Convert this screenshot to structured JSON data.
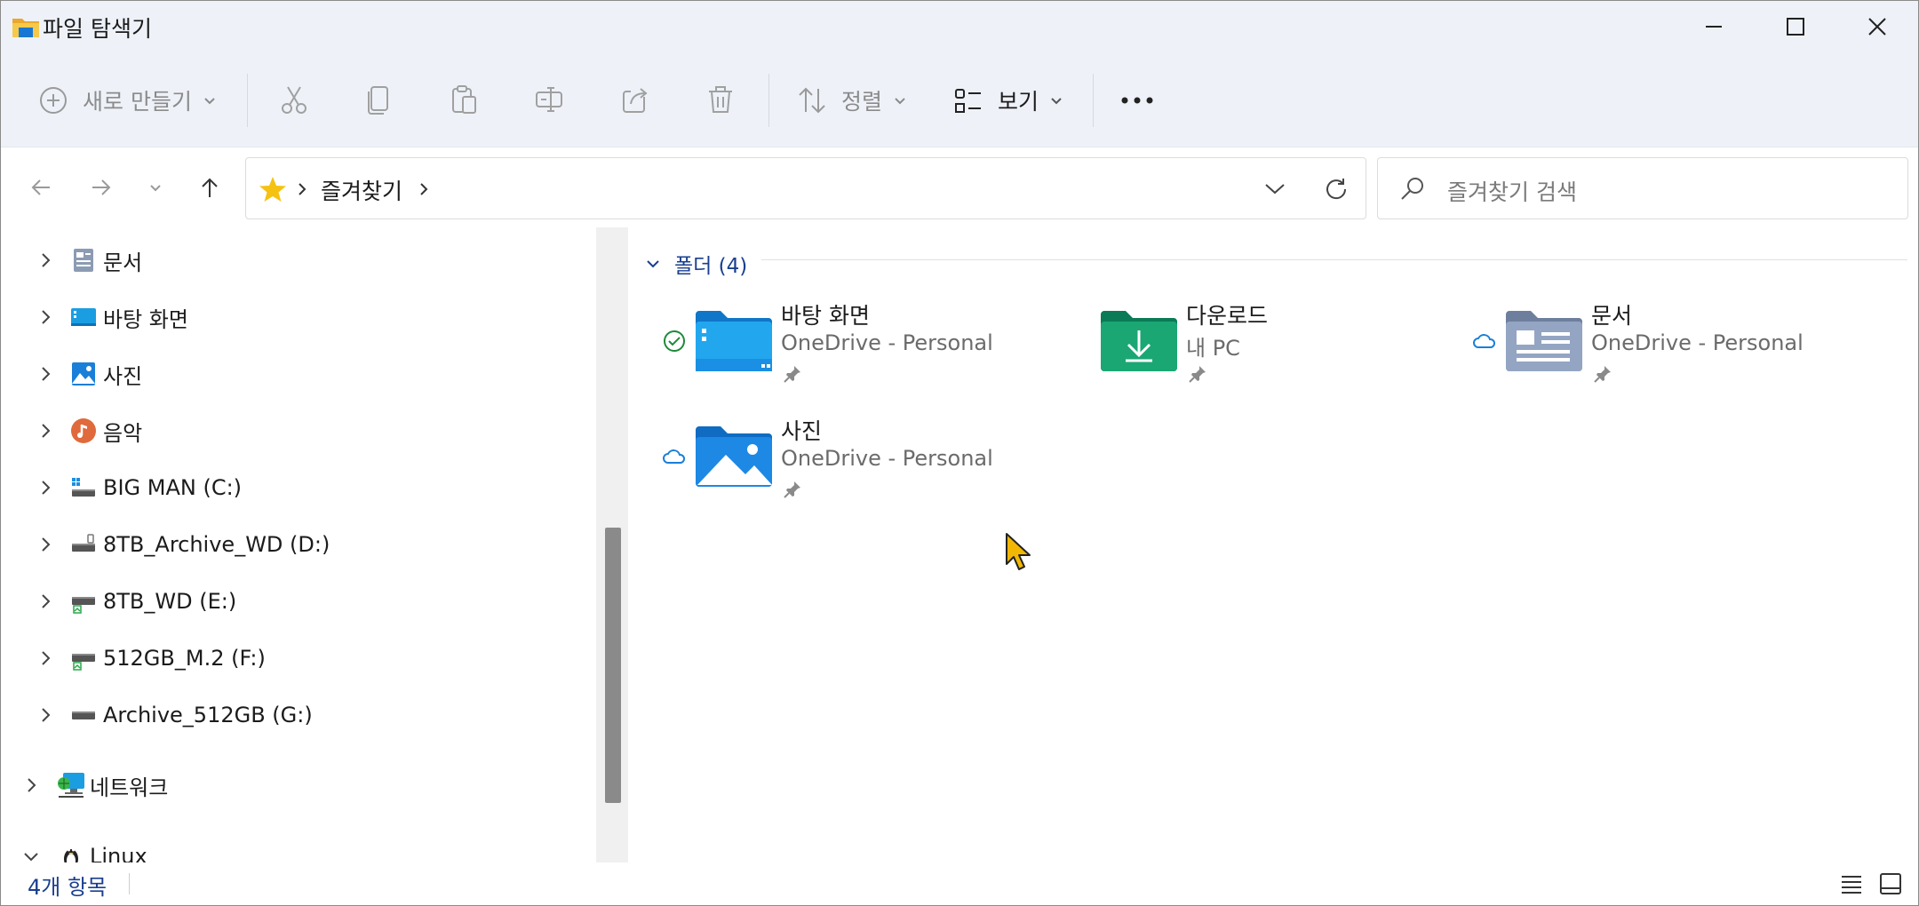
{
  "window": {
    "title": "파일 탐색기",
    "controls": [
      "minimize",
      "maximize",
      "close"
    ]
  },
  "toolbar": {
    "new_label": "새로 만들기",
    "sort_label": "정렬",
    "view_label": "보기",
    "icons": [
      "cut-icon",
      "copy-icon",
      "paste-icon",
      "rename-icon",
      "share-icon",
      "delete-icon",
      "more-icon"
    ]
  },
  "address": {
    "crumb": "즐겨찾기",
    "search_placeholder": "즐겨찾기 검색"
  },
  "nav_tree": [
    {
      "label": "문서",
      "icon": "documents-icon"
    },
    {
      "label": "바탕 화면",
      "icon": "desktop-icon"
    },
    {
      "label": "사진",
      "icon": "pictures-icon"
    },
    {
      "label": "음악",
      "icon": "music-icon"
    },
    {
      "label": "BIG MAN (C:)",
      "icon": "windows-drive-icon"
    },
    {
      "label": "8TB_Archive_WD (D:)",
      "icon": "drive-icon"
    },
    {
      "label": "8TB_WD (E:)",
      "icon": "drive-icon"
    },
    {
      "label": "512GB_M.2 (F:)",
      "icon": "drive-icon"
    },
    {
      "label": "Archive_512GB (G:)",
      "icon": "drive-icon"
    },
    {
      "label": "네트워크",
      "icon": "network-icon"
    },
    {
      "label": "Linux",
      "icon": "linux-icon"
    }
  ],
  "content": {
    "group_title": "폴더 (4)",
    "folders": [
      {
        "name": "바탕 화면",
        "location": "OneDrive - Personal",
        "status": "synced",
        "icon": "desktop-folder-icon"
      },
      {
        "name": "다운로드",
        "location": "내 PC",
        "status": "local",
        "icon": "downloads-folder-icon"
      },
      {
        "name": "문서",
        "location": "OneDrive - Personal",
        "status": "cloud",
        "icon": "documents-folder-icon"
      },
      {
        "name": "사진",
        "location": "OneDrive - Personal",
        "status": "cloud",
        "icon": "pictures-folder-icon"
      }
    ]
  },
  "status": {
    "count_text": "4개 항목"
  },
  "colors": {
    "chrome_bg": "#eef2f8",
    "accent_text": "#1a3f8f",
    "folder_blue": "#1a8fe3",
    "folder_green": "#1aa774"
  }
}
